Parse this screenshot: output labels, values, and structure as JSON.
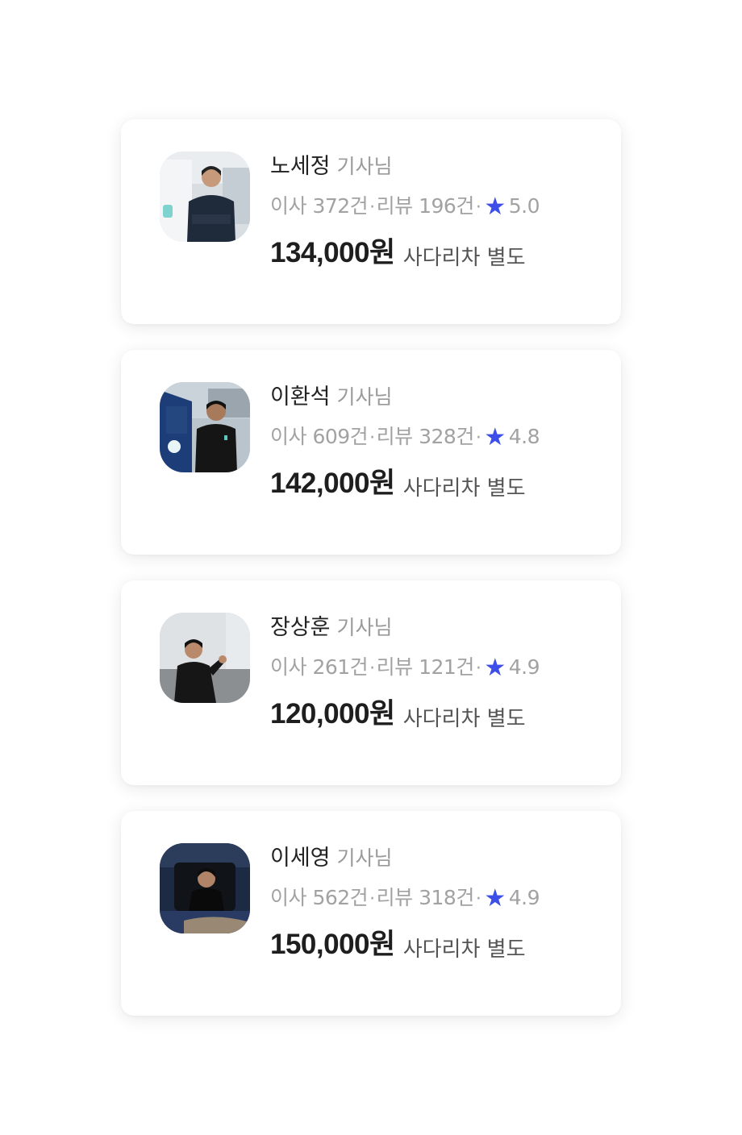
{
  "drivers": [
    {
      "name": "노세정",
      "title_suffix": "기사님",
      "moves_label": "이사 372건",
      "reviews_label": "리뷰 196건",
      "separator": "·",
      "rating": "5.0",
      "price": "134,000원",
      "note": "사다리차 별도",
      "avatar_icon": "driver-photo"
    },
    {
      "name": "이환석",
      "title_suffix": "기사님",
      "moves_label": "이사 609건",
      "reviews_label": "리뷰 328건",
      "separator": "·",
      "rating": "4.8",
      "price": "142,000원",
      "note": "사다리차 별도",
      "avatar_icon": "driver-photo"
    },
    {
      "name": "장상훈",
      "title_suffix": "기사님",
      "moves_label": "이사 261건",
      "reviews_label": "리뷰 121건",
      "separator": "·",
      "rating": "4.9",
      "price": "120,000원",
      "note": "사다리차 별도",
      "avatar_icon": "driver-photo"
    },
    {
      "name": "이세영",
      "title_suffix": "기사님",
      "moves_label": "이사 562건",
      "reviews_label": "리뷰 318건",
      "separator": "·",
      "rating": "4.9",
      "price": "150,000원",
      "note": "사다리차 별도",
      "avatar_icon": "driver-photo"
    }
  ],
  "colors": {
    "star": "#3d4fe8",
    "text_primary": "#222222",
    "text_secondary": "#a2a2a2"
  }
}
